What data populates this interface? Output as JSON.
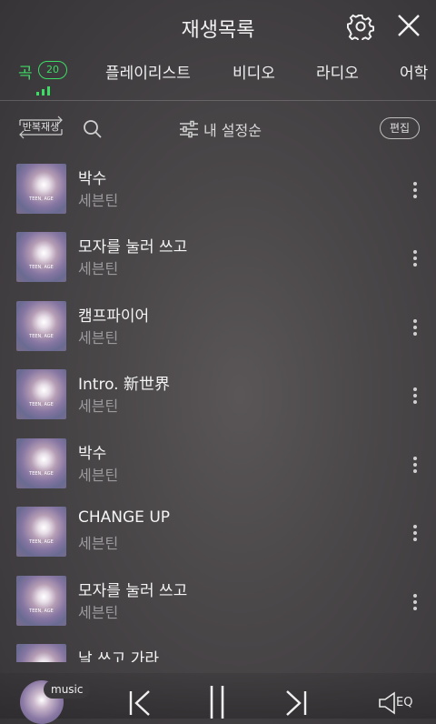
{
  "header": {
    "title": "재생목록"
  },
  "tabs": [
    {
      "label": "곡",
      "badge": "20",
      "active": true
    },
    {
      "label": "플레이리스트"
    },
    {
      "label": "비디오"
    },
    {
      "label": "라디오"
    },
    {
      "label": "어학"
    }
  ],
  "toolbar": {
    "repeat_label": "반복재생",
    "sort_label": "내 설정순",
    "edit_label": "편집"
  },
  "album_art_text": "TEEN, AGE",
  "songs": [
    {
      "title": "박수",
      "artist": "세븐틴"
    },
    {
      "title": "모자를 눌러 쓰고",
      "artist": "세븐틴"
    },
    {
      "title": "캠프파이어",
      "artist": "세븐틴"
    },
    {
      "title": "Intro. 新世界",
      "artist": "세븐틴"
    },
    {
      "title": "박수",
      "artist": "세븐틴"
    },
    {
      "title": "CHANGE UP",
      "artist": "세븐틴"
    },
    {
      "title": "모자를 눌러 쓰고",
      "artist": "세븐틴"
    },
    {
      "title": "날 쓰고 가라",
      "artist": ""
    }
  ],
  "player": {
    "disc_label": "music",
    "eq_label": "EQ"
  },
  "colors": {
    "accent": "#3ddc64",
    "background": "#4a4749",
    "muted_text": "#9c9a9c"
  }
}
